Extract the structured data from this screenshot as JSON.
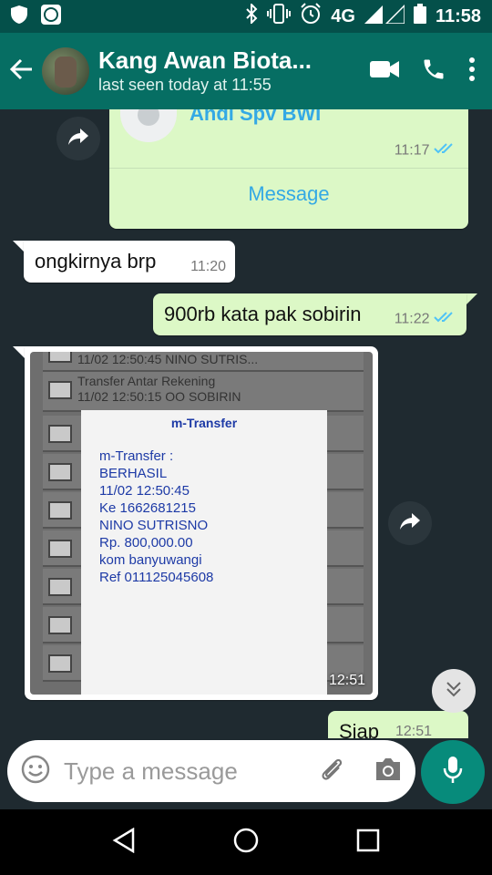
{
  "status_bar": {
    "network": "4G",
    "time": "11:58",
    "icons": [
      "shield-icon",
      "contact-card-icon",
      "bluetooth-icon",
      "vibrate-icon",
      "alarm-icon",
      "signal-icon",
      "battery-icon"
    ]
  },
  "header": {
    "contact_name": "Kang Awan Biota...",
    "last_seen": "last seen today at 11:55",
    "icons": [
      "back-arrow-icon",
      "video-call-icon",
      "phone-icon",
      "more-vert-icon"
    ]
  },
  "messages": {
    "contact_card": {
      "name": "Andi Spv BWI",
      "time": "11:17",
      "action_label": "Message"
    },
    "incoming_1": {
      "text": "ongkirnya brp",
      "time": "11:20"
    },
    "outgoing_1": {
      "text": "900rb kata pak sobirin",
      "time": "11:22"
    },
    "image_message": {
      "time": "12:51",
      "list_rows": [
        "11/02 12:50:45 NINO SUTRIS...",
        "Transfer Antar Rekening",
        "11/02 12:50:15 OO SOBIRIN"
      ],
      "receipt_title": "m-Transfer",
      "receipt_lines": [
        "m-Transfer :",
        "BERHASIL",
        "11/02 12:50:45",
        "Ke 1662681215",
        "NINO SUTRISNO",
        "Rp. 800,000.00",
        "kom banyuwangi",
        "Ref 011125045608"
      ]
    },
    "outgoing_2": {
      "text": "Siap",
      "time": "12:51"
    }
  },
  "composer": {
    "placeholder": "Type a message",
    "icons": [
      "emoji-icon",
      "attach-icon",
      "camera-icon",
      "mic-icon"
    ]
  },
  "nav_bar": {
    "icons": [
      "back-triangle-icon",
      "home-circle-icon",
      "recents-square-icon"
    ]
  },
  "colors": {
    "header": "#066e63",
    "status_bar": "#04504a",
    "chat_bg": "#1f2a30",
    "outgoing": "#dcf8c6",
    "incoming": "#ffffff",
    "link": "#34a9e4",
    "read_tick": "#4fc3f7",
    "mic_button": "#078b7b"
  }
}
